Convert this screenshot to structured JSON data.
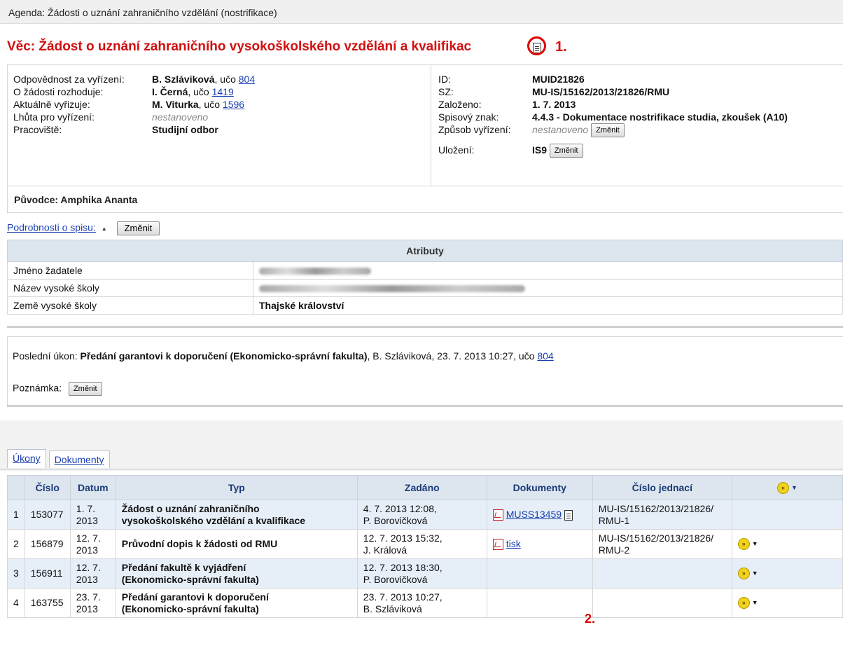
{
  "agenda": "Agenda: Žádosti o uznání zahraničního vzdělání (nostrifikace)",
  "title": "Věc: Žádost o uznání zahraničního vysokoškolského vzdělání a kvalifikac",
  "annotation_1": "1.",
  "annotation_2": "2.",
  "left_info": [
    {
      "label": "Odpovědnost za vyřízení:",
      "name": "B. Szláviková",
      "uco_text": ", učo ",
      "uco": "804"
    },
    {
      "label": "O žádosti rozhoduje:",
      "name": "I. Černá",
      "uco_text": ", učo ",
      "uco": "1419"
    },
    {
      "label": "Aktuálně vyřizuje:",
      "name": "M. Viturka",
      "uco_text": ", učo ",
      "uco": "1596"
    },
    {
      "label": "Lhůta pro vyřízení:",
      "value": "nestanoveno"
    },
    {
      "label": "Pracoviště:",
      "value": "Studijní odbor"
    }
  ],
  "right_info": {
    "id_label": "ID:",
    "id": "MUID21826",
    "sz_label": "SZ:",
    "sz": "MU-IS/15162/2013/21826/RMU",
    "zalozeno_label": "Založeno:",
    "zalozeno": "1. 7. 2013",
    "znak_label": "Spisový znak:",
    "znak_code": "4.4.3",
    "znak_text": " - Dokumentace nostrifikace studia, zkoušek (A10)",
    "zpusob_label": "Způsob vyřízení:",
    "zpusob": "nestanoveno",
    "ulozeni_label": "Uložení:",
    "ulozeni": "IS9"
  },
  "change_label": "Změnit",
  "puvodce_label": "Původce:",
  "puvodce": "Amphika Ananta",
  "podrobnosti": "Podrobnosti o spisu:",
  "attributes": {
    "header": "Atributy",
    "rows": [
      {
        "label": "Jméno žadatele",
        "value": ""
      },
      {
        "label": "Název vysoké školy",
        "value": ""
      },
      {
        "label": "Země vysoké školy",
        "value": "Thajské království"
      }
    ]
  },
  "posledni": {
    "label": "Poslední úkon: ",
    "action": "Předání garantovi k doporučení (Ekonomicko-správní fakulta)",
    "rest": ", B. Szláviková, 23. 7. 2013 10:27, učo ",
    "uco": "804"
  },
  "poznamka": "Poznámka:",
  "tabs": [
    "Úkony",
    "Dokumenty"
  ],
  "table": {
    "headers": [
      "",
      "Číslo",
      "Datum",
      "Typ",
      "Zadáno",
      "Dokumenty",
      "Číslo jednací"
    ],
    "rows": [
      {
        "n": "1",
        "cislo": "153077",
        "datum1": "1. 7.",
        "datum2": "2013",
        "typ1": "Žádost o uznání zahraničního",
        "typ2": "vysokoškolského vzdělání a kvalifikace",
        "zad1": "4. 7. 2013 12:08,",
        "zad2": "P. Borovičková",
        "doc": "MUSS13459",
        "cj1": "MU-IS/15162/2013/21826/",
        "cj2": "RMU-1"
      },
      {
        "n": "2",
        "cislo": "156879",
        "datum1": "12. 7.",
        "datum2": "2013",
        "typ1": "Průvodní dopis k žádosti od RMU",
        "typ2": "",
        "zad1": "12. 7. 2013 15:32,",
        "zad2": "J. Králová",
        "doc": "tisk",
        "cj1": "MU-IS/15162/2013/21826/",
        "cj2": "RMU-2"
      },
      {
        "n": "3",
        "cislo": "156911",
        "datum1": "12. 7.",
        "datum2": "2013",
        "typ1": "Předání fakultě k vyjádření",
        "typ2": "(Ekonomicko-správní fakulta)",
        "zad1": "12. 7. 2013 18:30,",
        "zad2": "P. Borovičková",
        "doc": "",
        "cj1": "",
        "cj2": ""
      },
      {
        "n": "4",
        "cislo": "163755",
        "datum1": "23. 7.",
        "datum2": "2013",
        "typ1": "Předání garantovi k doporučení",
        "typ2": "(Ekonomicko-správní fakulta)",
        "zad1": "23. 7. 2013 10:27,",
        "zad2": "B. Szláviková",
        "doc": "",
        "cj1": "",
        "cj2": ""
      }
    ]
  }
}
